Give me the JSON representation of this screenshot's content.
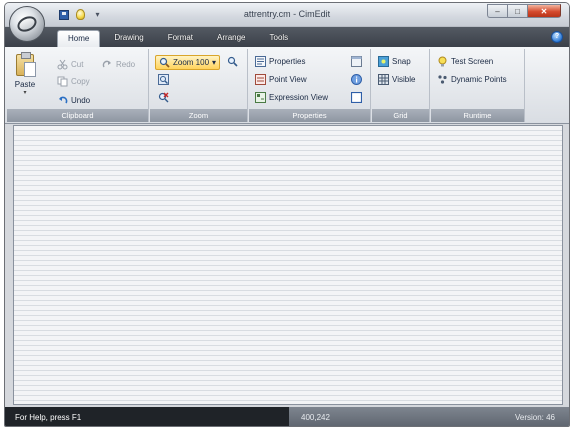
{
  "window": {
    "title": "attrentry.cm - CimEdit"
  },
  "quick_access": {
    "icons": [
      "save-icon",
      "bulb-icon"
    ],
    "dropdown_glyph": "▾"
  },
  "window_controls": {
    "minimize": "–",
    "maximize": "□",
    "close": "✕"
  },
  "tabs": [
    {
      "label": "Home",
      "active": true
    },
    {
      "label": "Drawing"
    },
    {
      "label": "Format"
    },
    {
      "label": "Arrange"
    },
    {
      "label": "Tools"
    }
  ],
  "help_glyph": "?",
  "ribbon": {
    "clipboard": {
      "label": "Clipboard",
      "paste": "Paste",
      "paste_arrow": "▾",
      "cut": "Cut",
      "copy": "Copy",
      "undo": "Undo",
      "redo": "Redo"
    },
    "zoom": {
      "label": "Zoom",
      "zoom_value": "Zoom 100",
      "zoom_arrow": "▾"
    },
    "properties": {
      "label": "Properties",
      "properties": "Properties",
      "point_view": "Point View",
      "expression_view": "Expression View"
    },
    "grid": {
      "label": "Grid",
      "snap": "Snap",
      "visible": "Visible"
    },
    "runtime": {
      "label": "Runtime",
      "test_screen": "Test Screen",
      "dynamic_points": "Dynamic Points"
    }
  },
  "status": {
    "help_text": "For Help, press F1",
    "coords": "400,242",
    "version": "Version: 46"
  },
  "colors": {
    "tabstrip": "#3b4049",
    "status_dark": "#1f2328",
    "zoom_highlight": "#ffd35c"
  }
}
